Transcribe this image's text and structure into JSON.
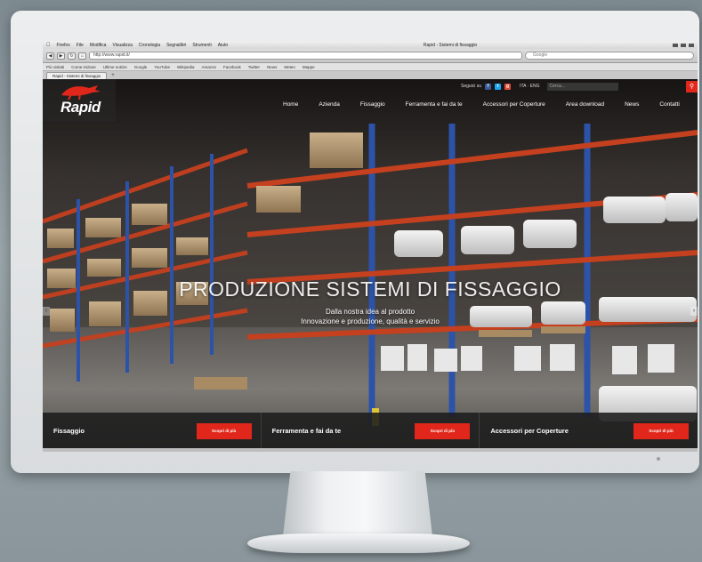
{
  "browser": {
    "menubar": {
      "app": "Firefox",
      "items": [
        "File",
        "Modifica",
        "Visualizza",
        "Cronologia",
        "Segnalibri",
        "Strumenti",
        "Aiuto"
      ],
      "window_title": "Rapid - Sistemi di fissaggio"
    },
    "url": "http://www.rapid.it/",
    "search_placeholder": "Google",
    "bookmarks": [
      "Più visitati",
      "Come iniziare",
      "Ultime notizie",
      "Google",
      "YouTube",
      "Wikipedia",
      "Amazon",
      "Facebook",
      "Twitter",
      "News",
      "Meteo",
      "Mappe"
    ],
    "tab_label": "Rapid - Sistemi di fissaggio"
  },
  "site": {
    "logo": "Rapid",
    "topbar": {
      "label": "Seguici su",
      "social": [
        {
          "name": "facebook-icon",
          "glyph": "f",
          "color": "#3b5998"
        },
        {
          "name": "twitter-icon",
          "glyph": "t",
          "color": "#1da1f2"
        },
        {
          "name": "googleplus-icon",
          "glyph": "g",
          "color": "#dd4b39"
        }
      ],
      "lang": "ITA · ENG",
      "search_placeholder": "Cerca..."
    },
    "nav": [
      "Home",
      "Azienda",
      "Fissaggio",
      "Ferramenta e fai da te",
      "Accessori per Coperture",
      "Area download",
      "News",
      "Contatti"
    ],
    "slider": {
      "title": "PRODUZIONE SISTEMI DI FISSAGGIO",
      "subtitle_1": "Dalla nostra idea al prodotto",
      "subtitle_2": "Innovazione e produzione, qualità e servizio"
    },
    "features": [
      {
        "title": "Fissaggio",
        "button": "Scopri di più"
      },
      {
        "title": "Ferramenta e fai da te",
        "button": "Scopri di più"
      },
      {
        "title": "Accessori per Coperture",
        "button": "Scopri di più"
      }
    ],
    "accent_color": "#e1271b"
  }
}
